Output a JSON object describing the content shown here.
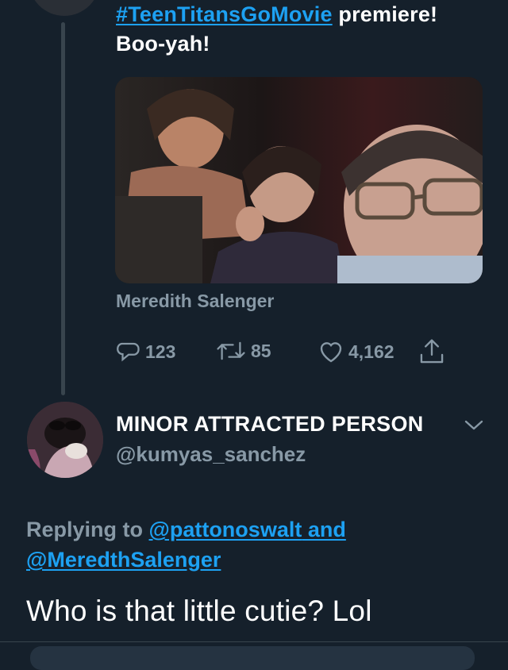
{
  "original_tweet": {
    "hashtag": "#TeenTitansGoMovie",
    "text_after_hashtag": " premiere!",
    "line2": "Boo-yah!",
    "photo_tag": "Meredith Salenger",
    "stats": {
      "replies": "123",
      "retweets": "85",
      "likes": "4,162"
    }
  },
  "reply": {
    "display_name": "MINOR ATTRACTED PERSON",
    "handle": "@kumyas_sanchez",
    "replying_prefix": "Replying to ",
    "mention1": "@pattonoswalt",
    "mention_joiner": " and",
    "mention2": "@MeredthSalenger",
    "body": "Who is that little cutie? Lol"
  },
  "colors": {
    "background": "#15202b",
    "link": "#1da1f2",
    "muted": "#8899a6"
  }
}
